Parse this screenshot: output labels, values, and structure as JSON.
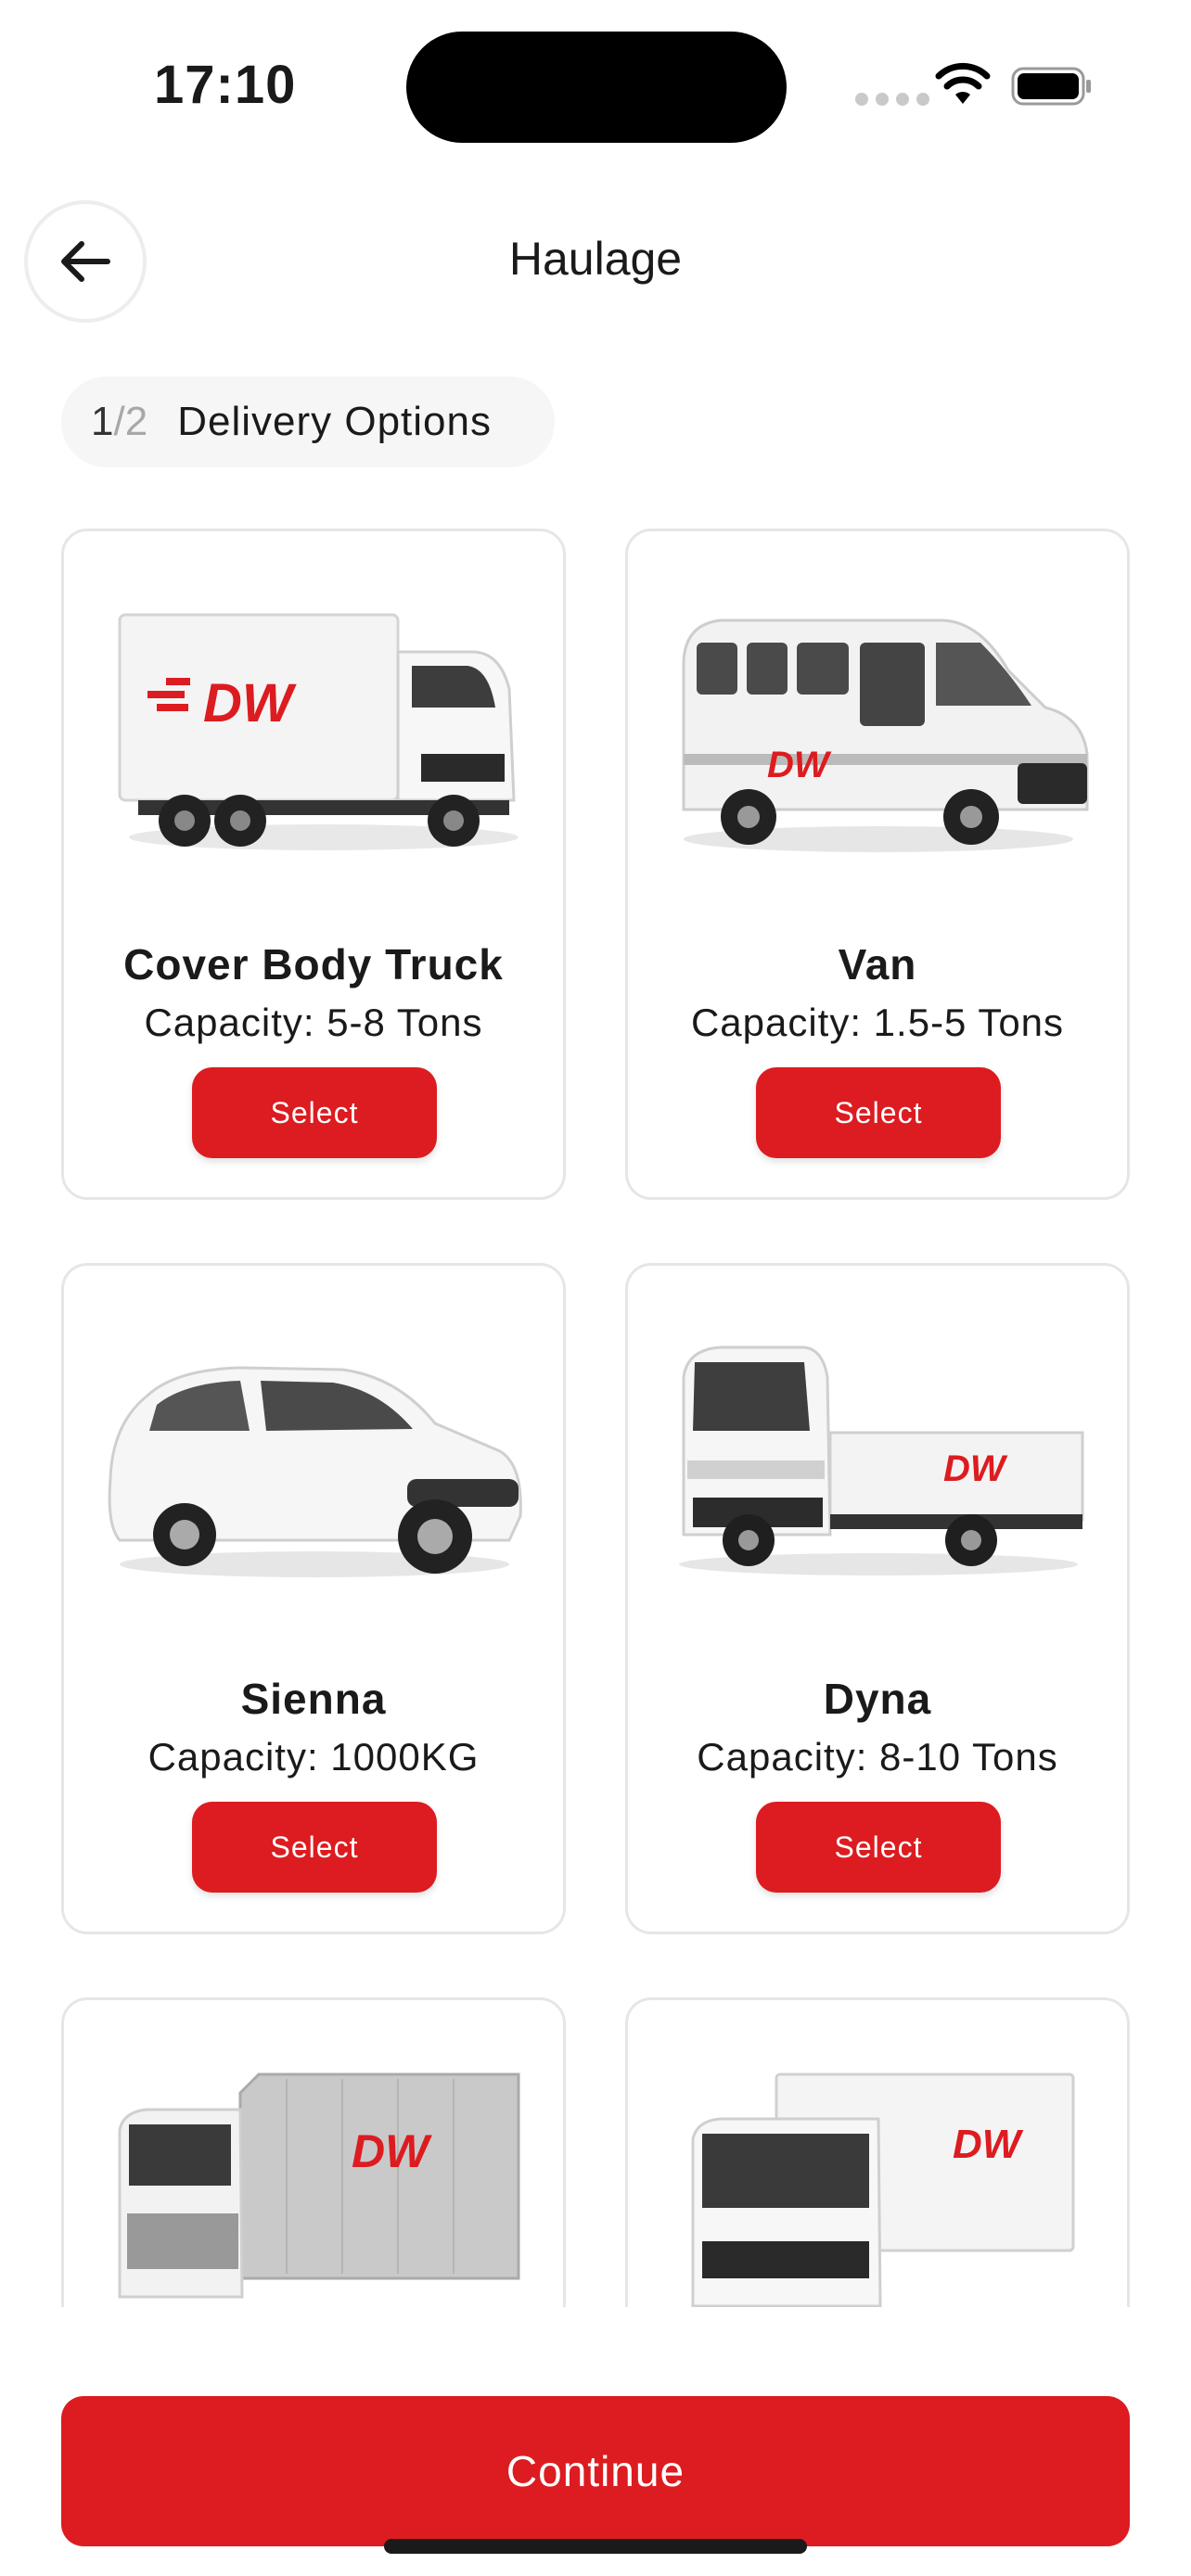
{
  "status_bar": {
    "time": "17:10"
  },
  "header": {
    "title": "Haulage"
  },
  "step": {
    "current": "1",
    "separator": "/",
    "total": "2",
    "label": "Delivery Options"
  },
  "vehicles": [
    {
      "name": "Cover Body Truck",
      "capacity": "Capacity: 5-8 Tons",
      "select_label": "Select",
      "logo": "DW"
    },
    {
      "name": "Van",
      "capacity": "Capacity: 1.5-5 Tons",
      "select_label": "Select",
      "logo": "DW"
    },
    {
      "name": "Sienna",
      "capacity": "Capacity: 1000KG",
      "select_label": "Select"
    },
    {
      "name": "Dyna",
      "capacity": "Capacity: 8-10 Tons",
      "select_label": "Select",
      "logo": "DW"
    },
    {
      "logo": "DW"
    },
    {
      "logo": "DW"
    }
  ],
  "footer": {
    "continue_label": "Continue"
  },
  "colors": {
    "accent": "#dc1c20",
    "card_border": "#e6e6e6",
    "pill_bg": "#f6f6f6"
  }
}
